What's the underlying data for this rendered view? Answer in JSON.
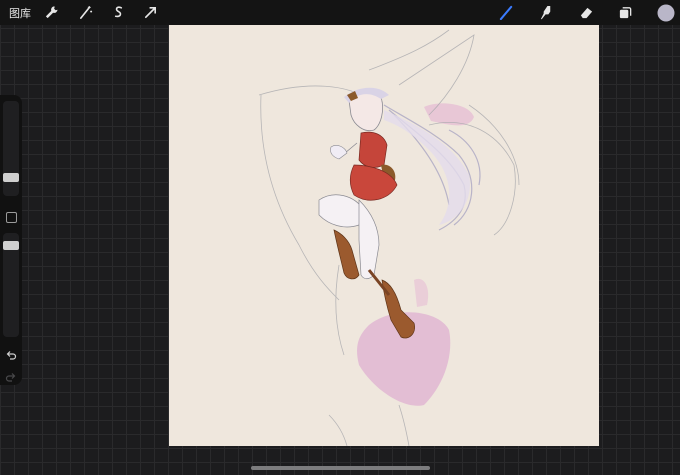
{
  "topbar": {
    "gallery_label": "图库",
    "left_tools": [
      {
        "icon": "wrench-icon"
      },
      {
        "icon": "magic-wand-icon"
      },
      {
        "icon": "selection-icon"
      },
      {
        "icon": "transform-arrow-icon"
      }
    ],
    "right_tools": [
      {
        "icon": "brush-icon",
        "active": true
      },
      {
        "icon": "smudge-icon",
        "active": false
      },
      {
        "icon": "eraser-icon",
        "active": false
      },
      {
        "icon": "layers-icon",
        "active": false
      },
      {
        "icon": "color-swatch-icon",
        "active": false
      }
    ],
    "accent_color": "#3a7bff",
    "current_color": "#b9b6c8"
  },
  "sidebar": {
    "brush_size_level": 0.75,
    "opacity_level": 0.25,
    "undo_icon": "undo-icon",
    "redo_icon": "redo-icon"
  },
  "canvas": {
    "background_color": "#efe7dd"
  }
}
